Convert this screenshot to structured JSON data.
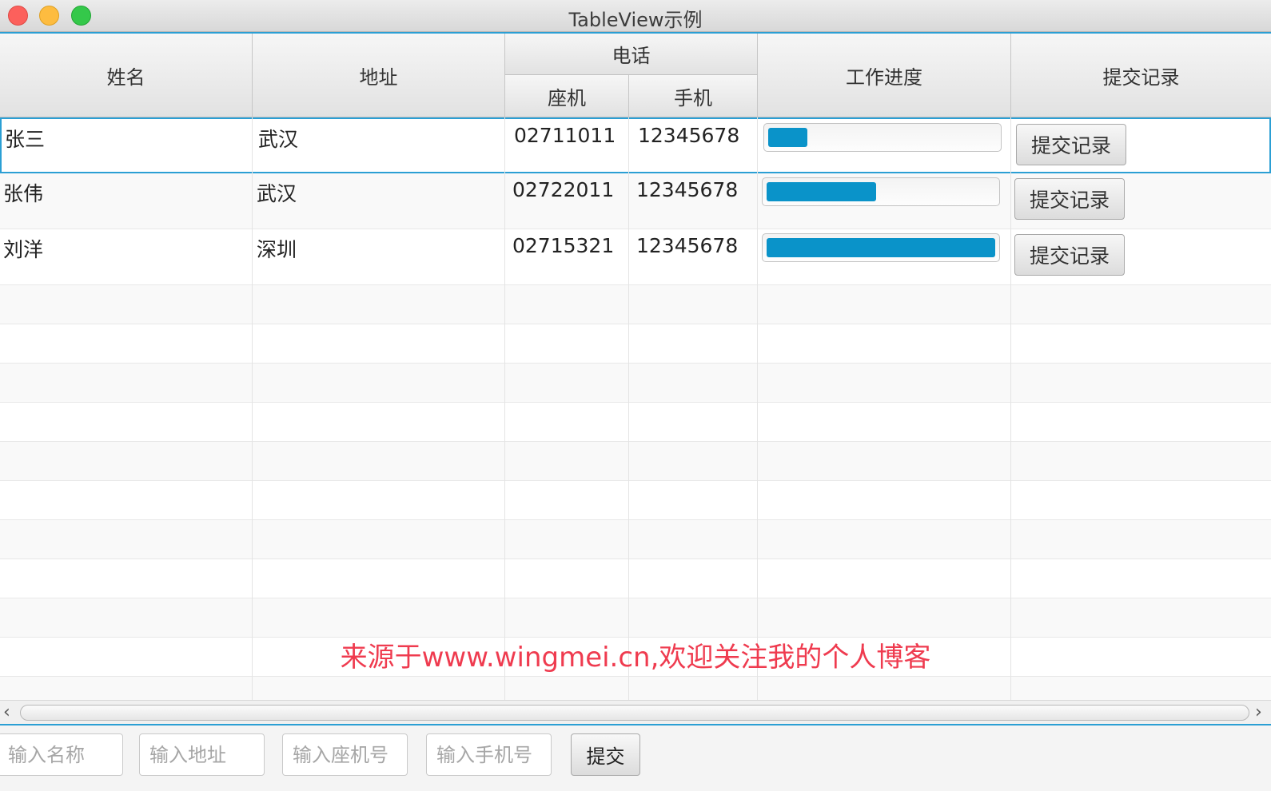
{
  "window": {
    "title": "TableView示例"
  },
  "table": {
    "headers": {
      "name": "姓名",
      "address": "地址",
      "phone_group": "电话",
      "landline": "座机",
      "mobile": "手机",
      "progress": "工作进度",
      "submit": "提交记录"
    },
    "rows": [
      {
        "name": "张三",
        "address": "武汉",
        "landline": "02711011",
        "mobile": "12345678",
        "progress": 0.17,
        "button": "提交记录"
      },
      {
        "name": "张伟",
        "address": "武汉",
        "landline": "02722011",
        "mobile": "12345678",
        "progress": 0.48,
        "button": "提交记录"
      },
      {
        "name": "刘洋",
        "address": "深圳",
        "landline": "02715321",
        "mobile": "12345678",
        "progress": 1.0,
        "button": "提交记录"
      }
    ],
    "progress_color": "#0a93c9",
    "selection_color": "#2b9fd4"
  },
  "watermark": "来源于www.wingmei.cn,欢迎关注我的个人博客",
  "form": {
    "name_placeholder": "输入名称",
    "address_placeholder": "输入地址",
    "landline_placeholder": "输入座机号",
    "mobile_placeholder": "输入手机号",
    "submit_label": "提交"
  }
}
